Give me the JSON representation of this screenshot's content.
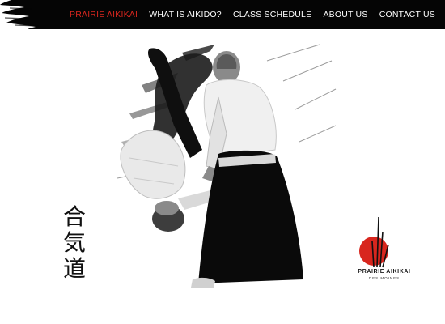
{
  "nav": {
    "items": [
      {
        "label": "PRAIRIE AIKIKAI",
        "active": true
      },
      {
        "label": "WHAT IS AIKIDO?",
        "active": false
      },
      {
        "label": "CLASS SCHEDULE",
        "active": false
      },
      {
        "label": "ABOUT US",
        "active": false
      },
      {
        "label": "CONTACT US",
        "active": false
      }
    ]
  },
  "hero": {
    "kanji": [
      "合",
      "気",
      "道"
    ]
  },
  "logo": {
    "name": "PRAIRIE AIKIKAI",
    "subtitle": "DES MOINES",
    "colors": {
      "sun": "#d8261e",
      "ink": "#111111"
    }
  },
  "colors": {
    "accent": "#d8261e",
    "nav_bg": "#050505",
    "nav_text": "#ffffff"
  }
}
